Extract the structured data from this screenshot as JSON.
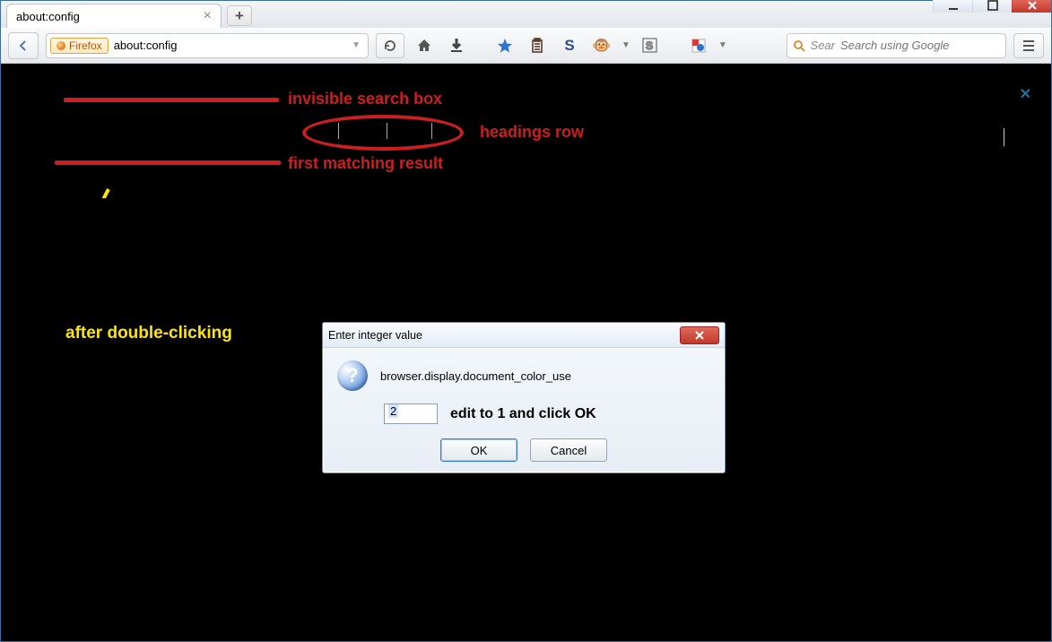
{
  "window": {
    "controls": {
      "minimize": "minimize",
      "maximize": "maximize",
      "close": "close"
    }
  },
  "tab": {
    "title": "about:config"
  },
  "navbar": {
    "identity_label": "Firefox",
    "url": "about:config",
    "search_placeholder": "Search using Google",
    "search_prefix": "Sear"
  },
  "annotations": {
    "invisible_search": "invisible search box",
    "headings_row": "headings row",
    "first_result": "first matching result",
    "after_dblclick": "after double-clicking",
    "edit_hint": "edit to 1 and click OK"
  },
  "dialog": {
    "title": "Enter integer value",
    "pref": "browser.display.document_color_use",
    "value": "2",
    "ok": "OK",
    "cancel": "Cancel"
  }
}
